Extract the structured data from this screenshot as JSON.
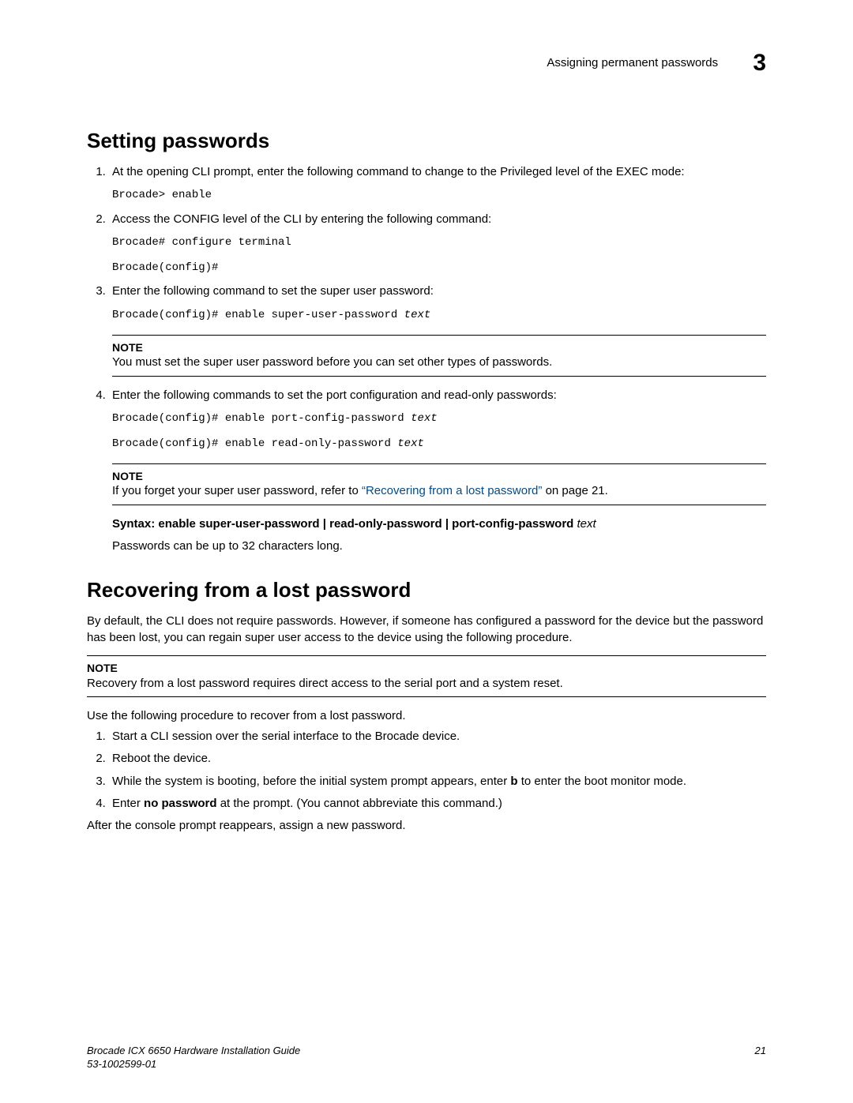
{
  "header": {
    "section_title": "Assigning permanent passwords",
    "chapter_number": "3"
  },
  "section1": {
    "heading": "Setting passwords",
    "step1": "At the opening CLI prompt, enter the following command to change to the Privileged level of the EXEC mode:",
    "code1": "Brocade> enable",
    "step2": "Access the CONFIG level of the CLI by entering the following command:",
    "code2a": "Brocade# configure terminal",
    "code2b": "Brocade(config)#",
    "step3": "Enter the following command to set the super user password:",
    "code3_prefix": "Brocade(config)# enable super-user-password ",
    "code3_italic": "text",
    "note1_label": "NOTE",
    "note1_text": "You must set the super user password before you can set other types of passwords.",
    "step4": "Enter the following commands to set the port configuration and read-only passwords:",
    "code4a_prefix": "Brocade(config)# enable port-config-password ",
    "code4a_italic": "text",
    "code4b_prefix": "Brocade(config)# enable read-only-password ",
    "code4b_italic": "text",
    "note2_label": "NOTE",
    "note2_pre": "If you forget your super user password, refer to ",
    "note2_link": "“Recovering from a lost password”",
    "note2_post": " on page 21.",
    "syntax_label": "Syntax: ",
    "syntax_bold": "enable super-user-password | read-only-password | port-config-password",
    "syntax_italic": " text",
    "pwd_len": "Passwords can be up to 32 characters long."
  },
  "section2": {
    "heading": "Recovering from a lost password",
    "intro": "By default, the CLI does not require passwords. However, if someone has configured a password for the device but the password has been lost, you can regain super user access to the device using the following procedure.",
    "note_label": "NOTE",
    "note_text": "Recovery from a lost password requires direct access to the serial port and a system reset.",
    "lead": "Use the following procedure to recover from a lost password.",
    "step1": "Start a CLI session over the serial interface to the Brocade device.",
    "step2": "Reboot the device.",
    "step3_pre": "While the system is booting, before the initial system prompt appears, enter ",
    "step3_bold": "b",
    "step3_post": " to enter the boot monitor mode.",
    "step4_pre": "Enter ",
    "step4_bold": "no password",
    "step4_post": " at the prompt. (You cannot abbreviate this command.)",
    "after": "After the console prompt reappears, assign a new password."
  },
  "footer": {
    "left_line1": "Brocade ICX 6650 Hardware Installation Guide",
    "left_line2": "53-1002599-01",
    "page_no": "21"
  }
}
